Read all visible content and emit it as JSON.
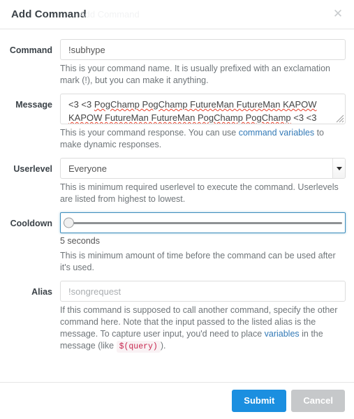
{
  "modal": {
    "title": "Add Command",
    "ghost_text": "Add Command",
    "close_icon": "close-icon"
  },
  "fields": {
    "command": {
      "label": "Command",
      "value": "!subhype",
      "placeholder": "",
      "help_before": "This is your command name. It is usually prefixed with an exclamation mark (!), but you can make it anything."
    },
    "message": {
      "label": "Message",
      "line1_plain_a": "<3 <3 ",
      "line1_sq_a": "PogChamp PogChamp FutureMan FutureMan KAPOW",
      "line2_sq_a": "KAPOW FutureMan FutureMan PogChamp PogChamp",
      "line2_plain_b": " <3 <3",
      "value": "<3 <3 PogChamp PogChamp FutureMan FutureMan KAPOW KAPOW FutureMan FutureMan PogChamp PogChamp <3 <3",
      "help_a": "This is your command response. You can use ",
      "help_link": "command variables",
      "help_b": " to make dynamic responses.",
      "resize_icon": "resize-grip-icon"
    },
    "userlevel": {
      "label": "Userlevel",
      "value": "Everyone",
      "arrow_icon": "chevron-down-icon",
      "help": "This is minimum required userlevel to execute the command. Userlevels are listed from highest to lowest."
    },
    "cooldown": {
      "label": "Cooldown",
      "value_text": "5 seconds",
      "slider_percent": 0,
      "help": "This is minimum amount of time before the command can be used after it's used."
    },
    "alias": {
      "label": "Alias",
      "value": "",
      "placeholder": "!songrequest",
      "help_a": "If this command is supposed to call another command, specify the other command here. Note that the input passed to the listed alias is the message. To capture user input, you'd need to place ",
      "help_link": "variables",
      "help_b": " in the message (like ",
      "help_code": "$(query)",
      "help_c": ")."
    }
  },
  "footer": {
    "submit_label": "Submit",
    "cancel_label": "Cancel"
  },
  "colors": {
    "primary": "#1b8fe0",
    "cancel": "#c6c8ca",
    "link": "#337ab7",
    "code": "#c7254e",
    "focus_border": "#3c8dbc",
    "spellcheck": "#e8402a"
  }
}
